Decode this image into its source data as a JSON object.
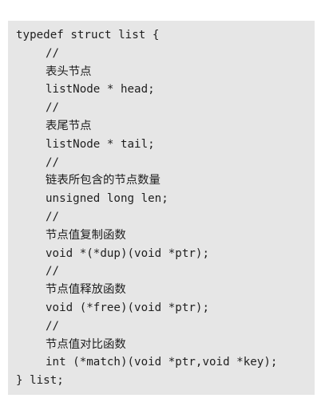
{
  "code": {
    "lines": [
      "typedef struct list {",
      "//",
      "表头节点",
      "listNode * head;",
      "//",
      "表尾节点",
      "listNode * tail;",
      "//",
      "链表所包含的节点数量",
      "unsigned long len;",
      "//",
      "节点值复制函数",
      "void *(*dup)(void *ptr);",
      "//",
      "节点值释放函数",
      "void (*free)(void *ptr);",
      "//",
      "节点值对比函数",
      "int (*match)(void *ptr,void *key);",
      "} list;"
    ]
  }
}
